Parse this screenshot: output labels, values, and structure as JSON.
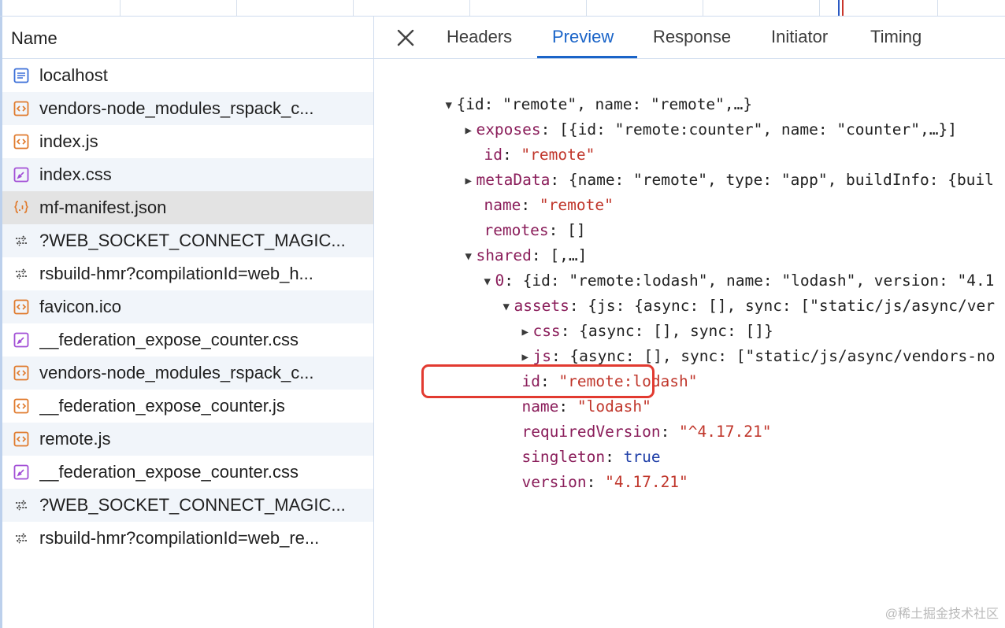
{
  "network": {
    "name_header": "Name",
    "requests": [
      {
        "name": "localhost",
        "icon": "document-icon",
        "color": "#3b6fd8"
      },
      {
        "name": "vendors-node_modules_rspack_c...",
        "icon": "script-icon",
        "color": "#e07a2c"
      },
      {
        "name": "index.js",
        "icon": "script-icon",
        "color": "#e07a2c"
      },
      {
        "name": "index.css",
        "icon": "stylesheet-icon",
        "color": "#a24fd6"
      },
      {
        "name": "mf-manifest.json",
        "icon": "json-icon",
        "color": "#e07a2c"
      },
      {
        "name": "?WEB_SOCKET_CONNECT_MAGIC...",
        "icon": "websocket-icon",
        "color": "#444444"
      },
      {
        "name": "rsbuild-hmr?compilationId=web_h...",
        "icon": "websocket-icon",
        "color": "#444444"
      },
      {
        "name": "favicon.ico",
        "icon": "script-icon",
        "color": "#e07a2c"
      },
      {
        "name": "__federation_expose_counter.css",
        "icon": "stylesheet-icon",
        "color": "#a24fd6"
      },
      {
        "name": "vendors-node_modules_rspack_c...",
        "icon": "script-icon",
        "color": "#e07a2c"
      },
      {
        "name": "__federation_expose_counter.js",
        "icon": "script-icon",
        "color": "#e07a2c"
      },
      {
        "name": "remote.js",
        "icon": "script-icon",
        "color": "#e07a2c"
      },
      {
        "name": "__federation_expose_counter.css",
        "icon": "stylesheet-icon",
        "color": "#a24fd6"
      },
      {
        "name": "?WEB_SOCKET_CONNECT_MAGIC...",
        "icon": "websocket-icon",
        "color": "#444444"
      },
      {
        "name": "rsbuild-hmr?compilationId=web_re...",
        "icon": "websocket-icon",
        "color": "#444444"
      }
    ],
    "selected_request": "mf-manifest.json"
  },
  "details": {
    "tabs": [
      "Headers",
      "Preview",
      "Response",
      "Initiator",
      "Timing"
    ],
    "active_tab": "Preview",
    "preview": {
      "root": "{id: \"remote\", name: \"remote\",…}",
      "exposes_key": "exposes",
      "exposes_val": "[{id: \"remote:counter\", name: \"counter\",…}]",
      "id_key": "id",
      "id_val": "\"remote\"",
      "metaData_key": "metaData",
      "metaData_val": "{name: \"remote\", type: \"app\", buildInfo: {buil",
      "name_key": "name",
      "name_val": "\"remote\"",
      "remotes_key": "remotes",
      "remotes_val": "[]",
      "shared_key": "shared",
      "shared_val": "[,…]",
      "shared0_key": "0",
      "shared0_val": "{id: \"remote:lodash\", name: \"lodash\", version: \"4.1",
      "assets_key": "assets",
      "assets_val": "{js: {async: [], sync: [\"static/js/async/ver",
      "css_key": "css",
      "css_val": "{async: [], sync: []}",
      "js_key": "js",
      "js_val": "{async: [], sync: [\"static/js/async/vendors-no",
      "s_id_key": "id",
      "s_id_val": "\"remote:lodash\"",
      "s_name_key": "name",
      "s_name_val": "\"lodash\"",
      "reqver_key": "requiredVersion",
      "reqver_val": "\"^4.17.21\"",
      "singleton_key": "singleton",
      "singleton_val": "true",
      "version_key": "version",
      "version_val": "\"4.17.21\""
    }
  },
  "watermark": "@稀土掘金技术社区",
  "colors": {
    "accent": "#1a64c8",
    "highlight_box": "#e23a30",
    "key": "#8a1d5a",
    "string": "#c0362b"
  }
}
